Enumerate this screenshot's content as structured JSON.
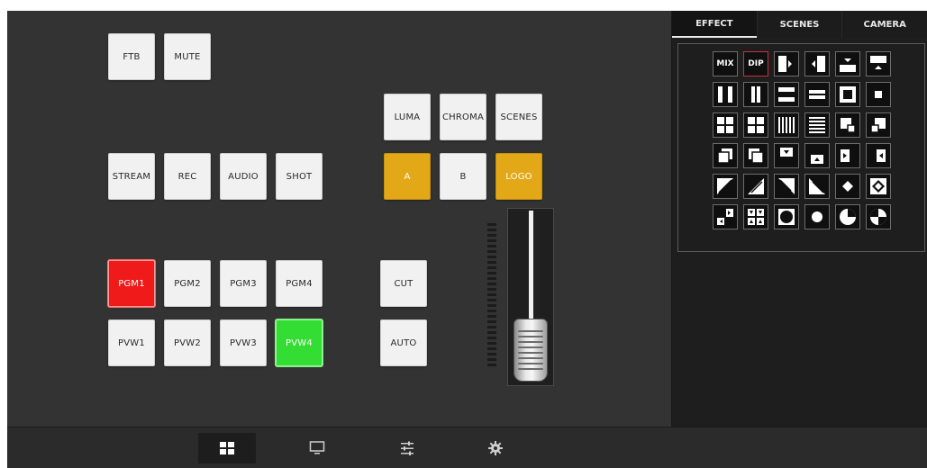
{
  "row_top": {
    "ftb": "FTB",
    "mute": "MUTE"
  },
  "keys_dsk": {
    "luma": "LUMA",
    "chroma": "CHROMA",
    "scenes": "SCENES"
  },
  "row_stream": {
    "stream": "STREAM",
    "rec": "REC",
    "audio": "AUDIO",
    "shot": "SHOT"
  },
  "layers": {
    "a": "A",
    "b": "B",
    "logo": "LOGO"
  },
  "program": [
    "PGM1",
    "PGM2",
    "PGM3",
    "PGM4"
  ],
  "preview": [
    "PVW1",
    "PVW2",
    "PVW3",
    "PVW4"
  ],
  "transition": {
    "cut": "CUT",
    "auto": "AUTO"
  },
  "program_active": "PGM1",
  "preview_active": "PVW4",
  "tbar": {
    "position": 0.0
  },
  "tabs": [
    {
      "label": "EFFECT",
      "active": true
    },
    {
      "label": "SCENES",
      "active": false
    },
    {
      "label": "CAMERA",
      "active": false
    }
  ],
  "effects": {
    "mix": "MIX",
    "dip": "DIP",
    "selected": "DIP"
  },
  "bottom_nav": [
    "grid-icon",
    "monitor-icon",
    "sliders-icon",
    "gear-icon"
  ],
  "colors": {
    "amber": "#e3a817",
    "program_red": "#ef1b1b",
    "preview_green": "#33dd33",
    "selected_outline": "#c9303c"
  }
}
